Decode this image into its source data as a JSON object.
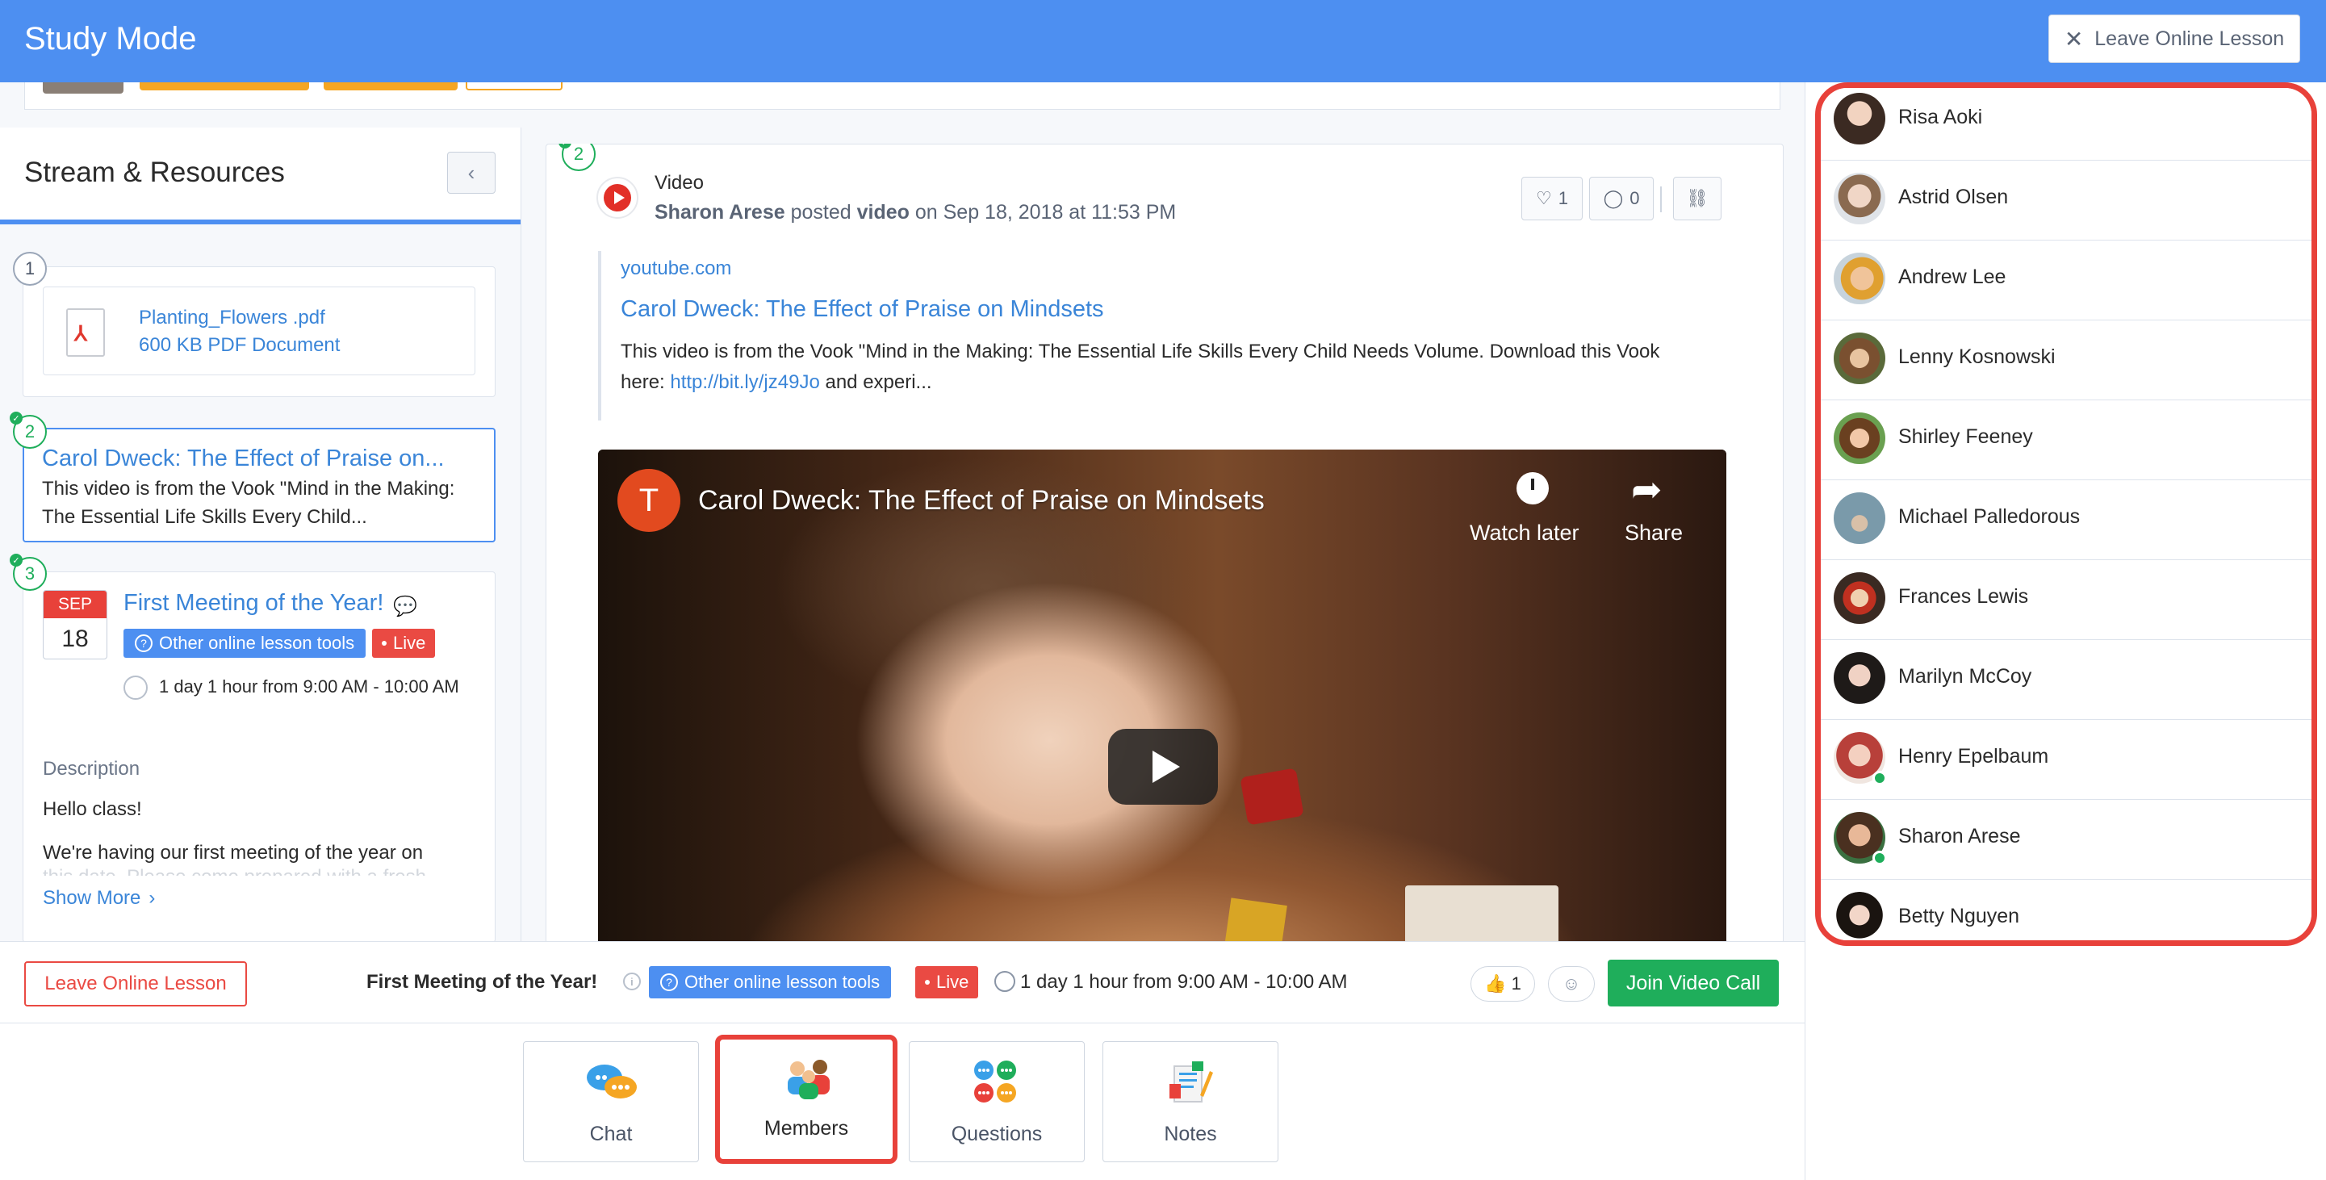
{
  "header": {
    "title": "Study Mode",
    "leave_label": "Leave Online Lesson"
  },
  "left_panel": {
    "title": "Stream & Resources",
    "items": [
      {
        "num": "1",
        "file_name": "Planting_Flowers .pdf",
        "file_size": "600 KB PDF Document"
      },
      {
        "num": "2",
        "title": "Carol Dweck: The Effect of Praise on...",
        "desc": "This video is from the Vook \"Mind in the Making: The Essential Life Skills Every Child..."
      },
      {
        "num": "3",
        "month": "SEP",
        "day": "18",
        "title": "First Meeting of the Year!",
        "tag_tools": "Other online lesson tools",
        "tag_live": "Live",
        "time": "1 day 1 hour from 9:00 AM - 10:00 AM",
        "desc_label": "Description",
        "desc_hello": "Hello class!",
        "desc_line1": "We're having our first meeting of the year on",
        "desc_line2": "this date. Please come prepared with a fresh",
        "show_more": "Show More"
      }
    ]
  },
  "post": {
    "num": "2",
    "type": "Video",
    "author": "Sharon Arese",
    "verb": "posted",
    "object": "video",
    "date": "on Sep 18, 2018 at 11:53 PM",
    "likes": "1",
    "comments": "0",
    "domain": "youtube.com",
    "link_title": "Carol Dweck: The Effect of Praise on Mindsets",
    "desc_a": "This video is from the Vook \"Mind in the Making: The Essential Life Skills Every Child Needs Volume. Download this Vook",
    "desc_b": "here: ",
    "desc_link": "http://bit.ly/jz49Jo",
    "desc_c": " and experi...",
    "video": {
      "channel_initial": "T",
      "title": "Carol Dweck: The Effect of Praise on Mindsets",
      "watch_later": "Watch later",
      "share": "Share"
    }
  },
  "event_bar": {
    "leave_label": "Leave Online Lesson",
    "title": "First Meeting of the Year!",
    "tag_tools": "Other online lesson tools",
    "tag_live": "Live",
    "time": "1 day 1 hour from 9:00 AM - 10:00 AM",
    "like_count": "1",
    "join_label": "Join Video Call"
  },
  "tools": [
    {
      "label": "Chat"
    },
    {
      "label": "Members"
    },
    {
      "label": "Questions"
    },
    {
      "label": "Notes"
    }
  ],
  "members": [
    {
      "name": "Risa Aoki",
      "online": false
    },
    {
      "name": "Astrid Olsen",
      "online": false
    },
    {
      "name": "Andrew Lee",
      "online": false
    },
    {
      "name": "Lenny Kosnowski",
      "online": false
    },
    {
      "name": "Shirley Feeney",
      "online": false
    },
    {
      "name": "Michael Palledorous",
      "online": false
    },
    {
      "name": "Frances Lewis",
      "online": false
    },
    {
      "name": "Marilyn McCoy",
      "online": false
    },
    {
      "name": "Henry Epelbaum",
      "online": true
    },
    {
      "name": "Sharon Arese",
      "online": true
    },
    {
      "name": "Betty Nguyen",
      "online": false
    }
  ],
  "colors": {
    "brand_blue": "#4d8ff1",
    "live_red": "#ea4a43",
    "join_green": "#1fae5b",
    "highlight_red": "#e8413a"
  }
}
